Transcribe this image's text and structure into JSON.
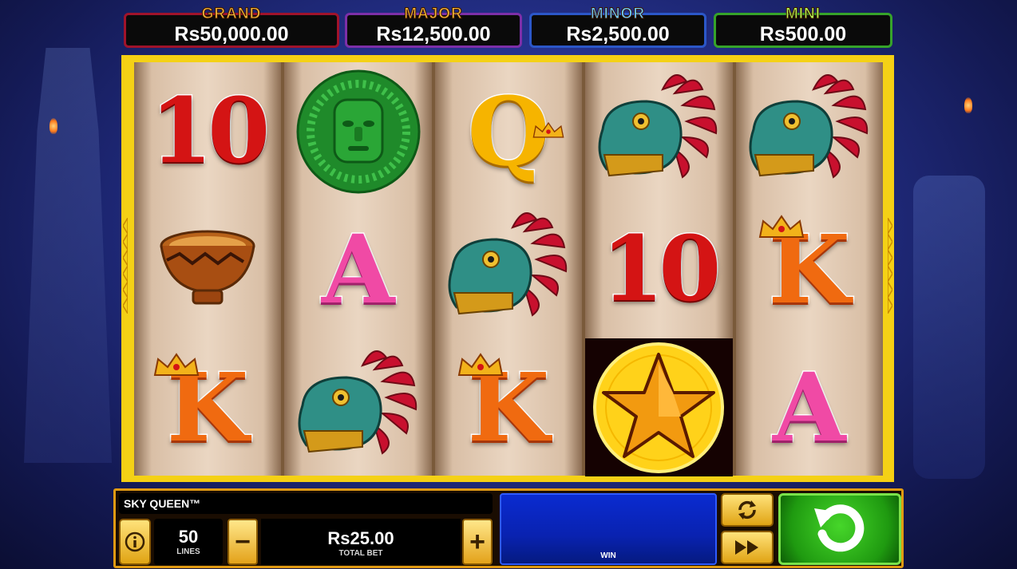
{
  "jackpots": {
    "grand": {
      "label": "GRAND",
      "value": "Rs50,000.00"
    },
    "major": {
      "label": "MAJOR",
      "value": "Rs12,500.00"
    },
    "minor": {
      "label": "MINOR",
      "value": "Rs2,500.00"
    },
    "mini": {
      "label": "MINI",
      "value": "Rs500.00"
    }
  },
  "reels": [
    [
      {
        "symbol": "ten",
        "text": "10"
      },
      {
        "symbol": "bowl"
      },
      {
        "symbol": "king",
        "text": "K"
      }
    ],
    [
      {
        "symbol": "jade-mask"
      },
      {
        "symbol": "ace",
        "text": "A"
      },
      {
        "symbol": "serpent"
      }
    ],
    [
      {
        "symbol": "queen",
        "text": "Q"
      },
      {
        "symbol": "serpent"
      },
      {
        "symbol": "king",
        "text": "K"
      }
    ],
    [
      {
        "symbol": "serpent"
      },
      {
        "symbol": "ten",
        "text": "10"
      },
      {
        "symbol": "star-wild"
      }
    ],
    [
      {
        "symbol": "serpent"
      },
      {
        "symbol": "king",
        "text": "K"
      },
      {
        "symbol": "ace",
        "text": "A"
      }
    ]
  ],
  "panel": {
    "game_name": "SKY QUEEN™",
    "lines_value": "50",
    "lines_label": "LINES",
    "bet_value": "Rs25.00",
    "bet_label": "TOTAL BET",
    "minus_label": "−",
    "plus_label": "+",
    "win_label": "WIN"
  },
  "icons": [
    "info-icon",
    "autoplay-icon",
    "turbo-icon",
    "spin-icon"
  ]
}
